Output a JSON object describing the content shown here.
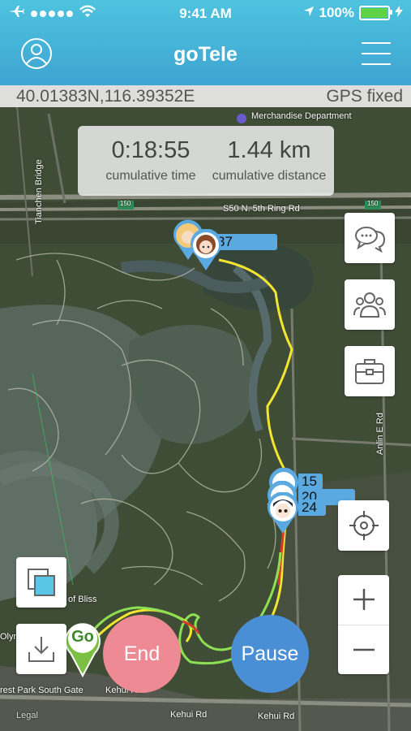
{
  "status_bar": {
    "time": "9:41 AM",
    "battery": "100%"
  },
  "header": {
    "title": "goTele"
  },
  "coords": {
    "position": "40.01383N,116.39352E",
    "gps_status": "GPS fixed"
  },
  "stats": {
    "cumulative_time": "0:18:55",
    "cumulative_time_label": "cumulative time",
    "cumulative_distance": "1.44 km",
    "cumulative_distance_label": "cumulative distance"
  },
  "markers": {
    "top_label": "37",
    "cluster_labels": [
      "15",
      "20",
      "24"
    ],
    "go": "Go"
  },
  "map_labels": {
    "merch": "Merchandise Department",
    "ring_road": "S50 N. 5th Ring Rd",
    "kehui1": "Kehui Rd",
    "kehui2": "Kehui Rd",
    "kehui3": "Kehui Rd",
    "south_gate": "rest Park South Gate",
    "bliss": "of Bliss",
    "legal": "Legal",
    "olym": "Olym",
    "tianchen": "Tianchen Bridge",
    "anlin": "Anlin E Rd",
    "shield150": "150",
    "shield150b": "150"
  },
  "buttons": {
    "end": "End",
    "pause": "Pause"
  },
  "colors": {
    "header": "#45b3da",
    "track_yellow": "#f2e631",
    "track_green": "#8ee053",
    "end": "#ee8a93",
    "pause": "#4a8ed5"
  }
}
